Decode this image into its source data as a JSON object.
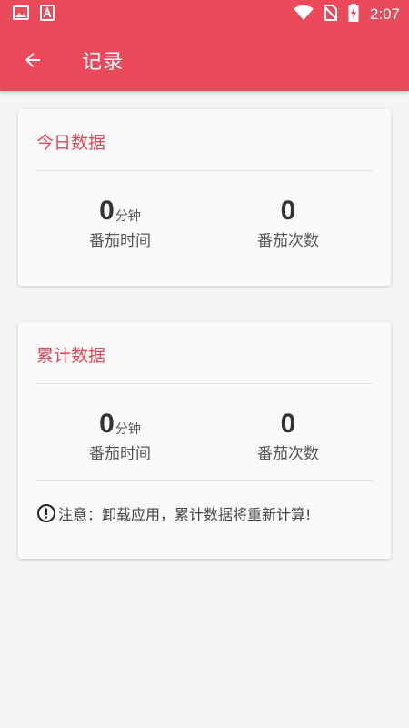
{
  "status_bar": {
    "time": "2:07",
    "icons": [
      "image-icon",
      "app-notification-icon",
      "wifi-icon",
      "no-sim-icon",
      "battery-charging-icon"
    ]
  },
  "app_bar": {
    "title": "记录",
    "back_icon": "arrow-left-icon"
  },
  "today": {
    "title": "今日数据",
    "duration_value": "0",
    "duration_unit": "分钟",
    "duration_label": "番茄时间",
    "count_value": "0",
    "count_label": "番茄次数"
  },
  "total": {
    "title": "累计数据",
    "duration_value": "0",
    "duration_unit": "分钟",
    "duration_label": "番茄时间",
    "count_value": "0",
    "count_label": "番茄次数",
    "notice": "注意：卸载应用，累计数据将重新计算!"
  },
  "colors": {
    "primary": "#ea4a5a",
    "accent_text": "#e0475a",
    "background": "#f4f4f4"
  }
}
